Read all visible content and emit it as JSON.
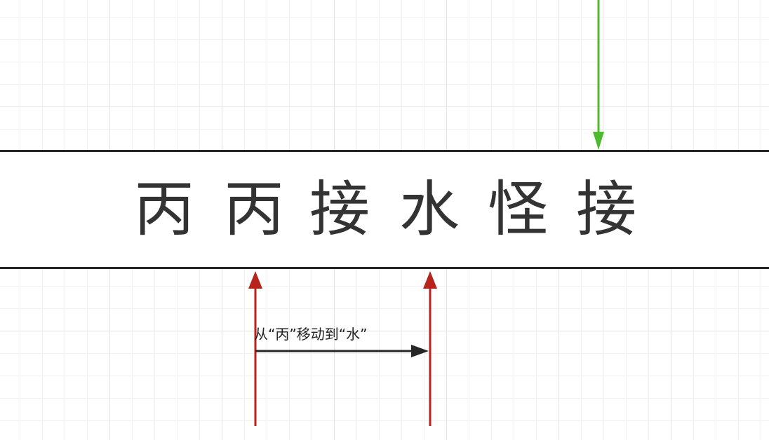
{
  "text_string": {
    "characters": [
      "丙",
      "丙",
      "接",
      "水",
      "怪",
      "接"
    ]
  },
  "annotation": {
    "label": "从“丙”移动到“水”"
  },
  "arrows": {
    "pattern_pointer_color": "#4dbb2d",
    "position_pointer_color": "#b8231c",
    "move_arrow_color": "#262626"
  }
}
